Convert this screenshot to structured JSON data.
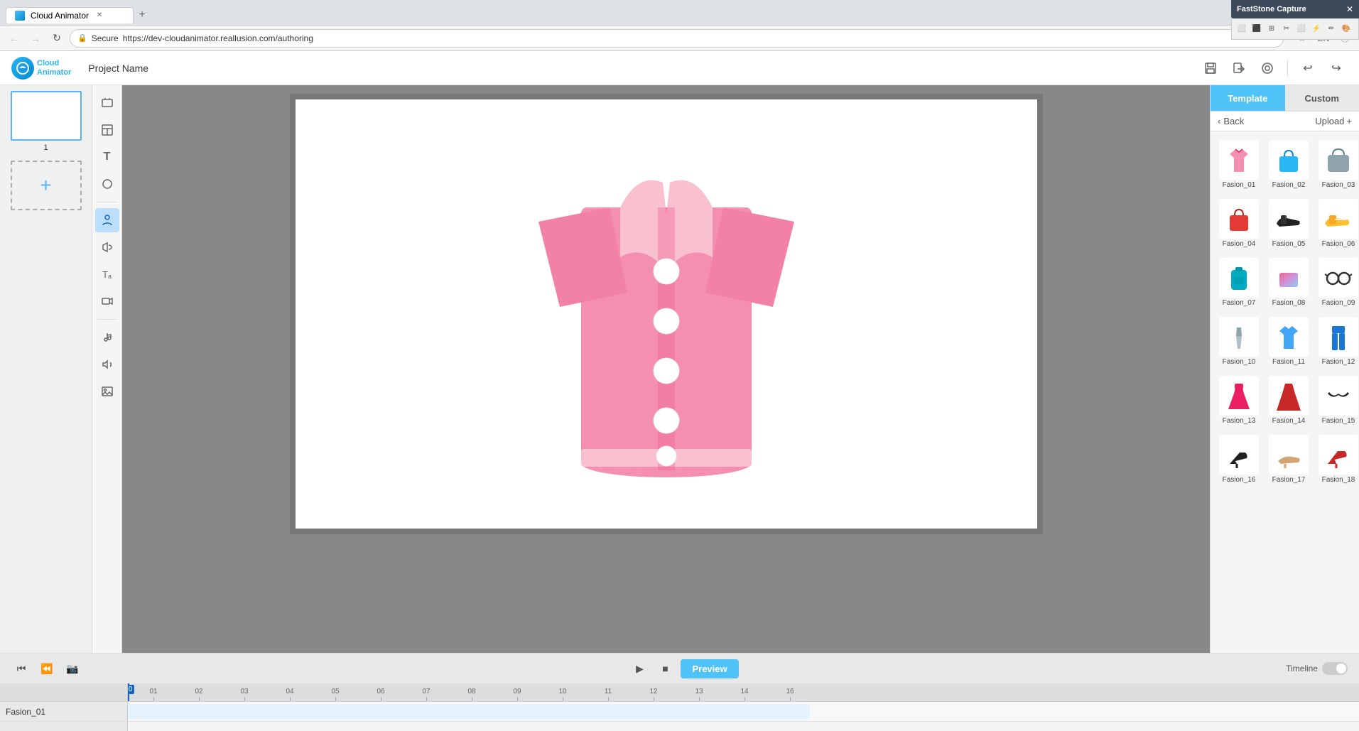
{
  "browser": {
    "tab_title": "Cloud Animator",
    "tab_favicon_alt": "cloud-animator-favicon",
    "url": "https://dev-cloudanimator.reallusion.com/authoring",
    "secure_label": "Secure",
    "person_label": "Person",
    "nav": {
      "back_label": "←",
      "forward_label": "→",
      "refresh_label": "↻",
      "home_label": "⌂"
    },
    "win_controls": {
      "minimize": "—",
      "maximize": "□",
      "close": "✕"
    }
  },
  "faststone": {
    "title": "FastStone Capture",
    "close_label": "✕",
    "toolbar_icons": [
      "□",
      "□",
      "⊞",
      "✂",
      "□",
      "⚡",
      "✎",
      "🎨"
    ]
  },
  "app": {
    "logo_text_line1": "Cloud",
    "logo_text_line2": "Animator",
    "project_name": "Project Name",
    "lang": "EN",
    "tools": {
      "save_icon": "💾",
      "export_icon": "📤",
      "share_icon": "👁",
      "undo_icon": "↩",
      "redo_icon": "↪"
    }
  },
  "slides": {
    "items": [
      {
        "num": "1"
      }
    ],
    "add_label": "+"
  },
  "left_toolbar": {
    "items": [
      {
        "icon": "📁",
        "label": "media",
        "active": false
      },
      {
        "icon": "≡",
        "label": "layout",
        "active": false
      },
      {
        "icon": "T",
        "label": "text",
        "active": false
      },
      {
        "icon": "◷",
        "label": "shape",
        "active": false
      },
      {
        "icon": "👤",
        "label": "character",
        "active": true
      },
      {
        "icon": "🔊",
        "label": "audio",
        "active": false
      },
      {
        "icon": "Tₐ",
        "label": "font",
        "active": false
      },
      {
        "icon": "▶",
        "label": "video",
        "active": false
      },
      {
        "icon": "♪",
        "label": "music",
        "active": false
      },
      {
        "icon": "🎵",
        "label": "sound",
        "active": false
      },
      {
        "icon": "🖼",
        "label": "image",
        "active": false
      }
    ]
  },
  "right_panel": {
    "tab_template": "Template",
    "tab_custom": "Custom",
    "back_label": "Back",
    "upload_label": "Upload",
    "upload_plus": "+",
    "templates": [
      {
        "id": "Fasion_01",
        "label": "Fasion_01",
        "color_class": "t-shirt-pink"
      },
      {
        "id": "Fasion_02",
        "label": "Fasion_02",
        "color_class": "t-bag-blue"
      },
      {
        "id": "Fasion_03",
        "label": "Fasion_03",
        "color_class": "t-bag-gray"
      },
      {
        "id": "Fasion_04",
        "label": "Fasion_04",
        "color_class": "t-bag-red"
      },
      {
        "id": "Fasion_05",
        "label": "Fasion_05",
        "color_class": "t-shoe-black"
      },
      {
        "id": "Fasion_06",
        "label": "Fasion_06",
        "color_class": "t-shoe-yellow"
      },
      {
        "id": "Fasion_07",
        "label": "Fasion_07",
        "color_class": "t-bag-cyan"
      },
      {
        "id": "Fasion_08",
        "label": "Fasion_08",
        "color_class": "t-rainbow"
      },
      {
        "id": "Fasion_09",
        "label": "Fasion_09",
        "color_class": "t-glass-black"
      },
      {
        "id": "Fasion_10",
        "label": "Fasion_10",
        "color_class": "t-tie-gray"
      },
      {
        "id": "Fasion_11",
        "label": "Fasion_11",
        "color_class": "t-shirt-blue"
      },
      {
        "id": "Fasion_12",
        "label": "Fasion_12",
        "color_class": "t-pants-blue"
      },
      {
        "id": "Fasion_13",
        "label": "Fasion_13",
        "color_class": "t-dress-pink"
      },
      {
        "id": "Fasion_14",
        "label": "Fasion_14",
        "color_class": "t-dress-red"
      },
      {
        "id": "Fasion_15",
        "label": "Fasion_15",
        "color_class": "t-bra-black"
      },
      {
        "id": "Fasion_16",
        "label": "Fasion_16",
        "color_class": "t-heel-black"
      },
      {
        "id": "Fasion_17",
        "label": "Fasion_17",
        "color_class": "t-sandal-tan"
      },
      {
        "id": "Fasion_18",
        "label": "Fasion_18",
        "color_class": "t-heel-red"
      }
    ]
  },
  "timeline": {
    "preview_label": "Preview",
    "timeline_label": "Timeline",
    "play_icon": "▶",
    "stop_icon": "■",
    "current_time": "00.0",
    "ruler_marks": [
      "01",
      "02",
      "03",
      "04",
      "05",
      "06",
      "07",
      "08",
      "09",
      "10",
      "11",
      "12",
      "13",
      "14",
      "16"
    ],
    "track_name": "Fasion_01",
    "controls": {
      "rewind_icon": "⏮",
      "step_back_icon": "⏪",
      "screenshot_icon": "📷"
    }
  },
  "colors": {
    "accent_blue": "#4fc3f7",
    "active_tab_bg": "#4fc3f7",
    "cursor_blue": "#1565c0",
    "slide_border": "#5bb3f5"
  }
}
